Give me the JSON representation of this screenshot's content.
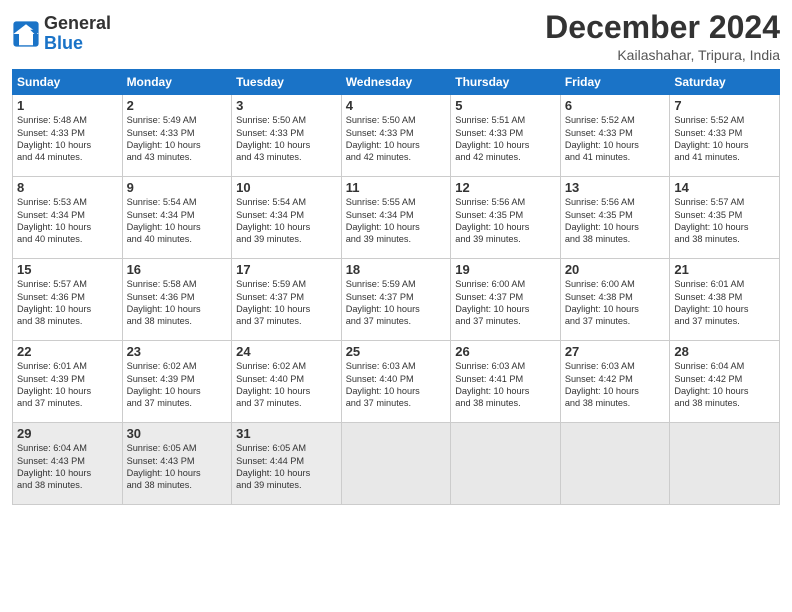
{
  "logo": {
    "general": "General",
    "blue": "Blue"
  },
  "title": "December 2024",
  "location": "Kailashahar, Tripura, India",
  "days_of_week": [
    "Sunday",
    "Monday",
    "Tuesday",
    "Wednesday",
    "Thursday",
    "Friday",
    "Saturday"
  ],
  "weeks": [
    [
      {
        "day": 1,
        "info": "Sunrise: 5:48 AM\nSunset: 4:33 PM\nDaylight: 10 hours\nand 44 minutes."
      },
      {
        "day": 2,
        "info": "Sunrise: 5:49 AM\nSunset: 4:33 PM\nDaylight: 10 hours\nand 43 minutes."
      },
      {
        "day": 3,
        "info": "Sunrise: 5:50 AM\nSunset: 4:33 PM\nDaylight: 10 hours\nand 43 minutes."
      },
      {
        "day": 4,
        "info": "Sunrise: 5:50 AM\nSunset: 4:33 PM\nDaylight: 10 hours\nand 42 minutes."
      },
      {
        "day": 5,
        "info": "Sunrise: 5:51 AM\nSunset: 4:33 PM\nDaylight: 10 hours\nand 42 minutes."
      },
      {
        "day": 6,
        "info": "Sunrise: 5:52 AM\nSunset: 4:33 PM\nDaylight: 10 hours\nand 41 minutes."
      },
      {
        "day": 7,
        "info": "Sunrise: 5:52 AM\nSunset: 4:33 PM\nDaylight: 10 hours\nand 41 minutes."
      }
    ],
    [
      {
        "day": 8,
        "info": "Sunrise: 5:53 AM\nSunset: 4:34 PM\nDaylight: 10 hours\nand 40 minutes."
      },
      {
        "day": 9,
        "info": "Sunrise: 5:54 AM\nSunset: 4:34 PM\nDaylight: 10 hours\nand 40 minutes."
      },
      {
        "day": 10,
        "info": "Sunrise: 5:54 AM\nSunset: 4:34 PM\nDaylight: 10 hours\nand 39 minutes."
      },
      {
        "day": 11,
        "info": "Sunrise: 5:55 AM\nSunset: 4:34 PM\nDaylight: 10 hours\nand 39 minutes."
      },
      {
        "day": 12,
        "info": "Sunrise: 5:56 AM\nSunset: 4:35 PM\nDaylight: 10 hours\nand 39 minutes."
      },
      {
        "day": 13,
        "info": "Sunrise: 5:56 AM\nSunset: 4:35 PM\nDaylight: 10 hours\nand 38 minutes."
      },
      {
        "day": 14,
        "info": "Sunrise: 5:57 AM\nSunset: 4:35 PM\nDaylight: 10 hours\nand 38 minutes."
      }
    ],
    [
      {
        "day": 15,
        "info": "Sunrise: 5:57 AM\nSunset: 4:36 PM\nDaylight: 10 hours\nand 38 minutes."
      },
      {
        "day": 16,
        "info": "Sunrise: 5:58 AM\nSunset: 4:36 PM\nDaylight: 10 hours\nand 38 minutes."
      },
      {
        "day": 17,
        "info": "Sunrise: 5:59 AM\nSunset: 4:37 PM\nDaylight: 10 hours\nand 37 minutes."
      },
      {
        "day": 18,
        "info": "Sunrise: 5:59 AM\nSunset: 4:37 PM\nDaylight: 10 hours\nand 37 minutes."
      },
      {
        "day": 19,
        "info": "Sunrise: 6:00 AM\nSunset: 4:37 PM\nDaylight: 10 hours\nand 37 minutes."
      },
      {
        "day": 20,
        "info": "Sunrise: 6:00 AM\nSunset: 4:38 PM\nDaylight: 10 hours\nand 37 minutes."
      },
      {
        "day": 21,
        "info": "Sunrise: 6:01 AM\nSunset: 4:38 PM\nDaylight: 10 hours\nand 37 minutes."
      }
    ],
    [
      {
        "day": 22,
        "info": "Sunrise: 6:01 AM\nSunset: 4:39 PM\nDaylight: 10 hours\nand 37 minutes."
      },
      {
        "day": 23,
        "info": "Sunrise: 6:02 AM\nSunset: 4:39 PM\nDaylight: 10 hours\nand 37 minutes."
      },
      {
        "day": 24,
        "info": "Sunrise: 6:02 AM\nSunset: 4:40 PM\nDaylight: 10 hours\nand 37 minutes."
      },
      {
        "day": 25,
        "info": "Sunrise: 6:03 AM\nSunset: 4:40 PM\nDaylight: 10 hours\nand 37 minutes."
      },
      {
        "day": 26,
        "info": "Sunrise: 6:03 AM\nSunset: 4:41 PM\nDaylight: 10 hours\nand 38 minutes."
      },
      {
        "day": 27,
        "info": "Sunrise: 6:03 AM\nSunset: 4:42 PM\nDaylight: 10 hours\nand 38 minutes."
      },
      {
        "day": 28,
        "info": "Sunrise: 6:04 AM\nSunset: 4:42 PM\nDaylight: 10 hours\nand 38 minutes."
      }
    ],
    [
      {
        "day": 29,
        "info": "Sunrise: 6:04 AM\nSunset: 4:43 PM\nDaylight: 10 hours\nand 38 minutes."
      },
      {
        "day": 30,
        "info": "Sunrise: 6:05 AM\nSunset: 4:43 PM\nDaylight: 10 hours\nand 38 minutes."
      },
      {
        "day": 31,
        "info": "Sunrise: 6:05 AM\nSunset: 4:44 PM\nDaylight: 10 hours\nand 39 minutes."
      },
      null,
      null,
      null,
      null
    ]
  ]
}
